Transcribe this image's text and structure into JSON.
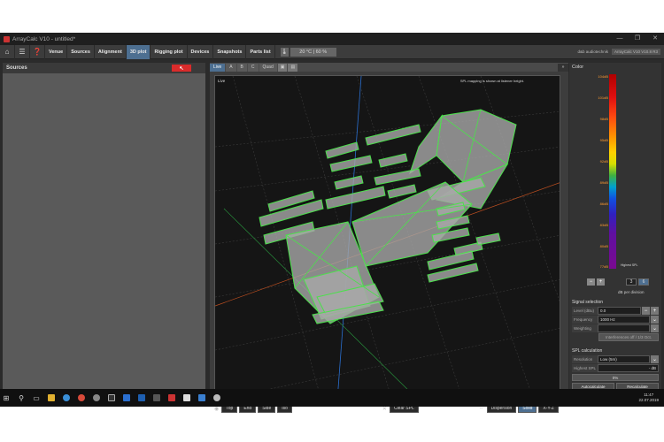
{
  "window": {
    "title": "ArrayCalc V10 - untitled*",
    "controls": [
      "—",
      "❐",
      "✕"
    ]
  },
  "toolbar": {
    "buttons": [
      "Venue",
      "Sources",
      "Alignment",
      "3D plot",
      "Rigging plot",
      "Devices",
      "Snapshots",
      "Parts list"
    ],
    "active": "3D plot",
    "temperature": "20 °C | 60 %",
    "brand_left": "d&b audiotechnik",
    "brand_right": "ArrayCalc V10\nV10.8 R3"
  },
  "sources_panel": {
    "title": "Sources"
  },
  "view": {
    "tabs": [
      "Live",
      "A",
      "B",
      "C",
      "Quad"
    ],
    "active_tab": "Live",
    "scene_label": "Live",
    "scene_note": "SPL mapping is shown at listener height.",
    "view_buttons": [
      "Top",
      "End",
      "Side",
      "Iso"
    ],
    "clear_label": "Clear SPL",
    "render_buttons": [
      "Dispersion",
      "Solid",
      "X-Y-Z"
    ],
    "active_render": "Solid"
  },
  "color_panel": {
    "title": "Color",
    "scale_labels": [
      "104dB",
      "101dB",
      "98dB",
      "95dB",
      "92dB",
      "89dB",
      "86dB",
      "83dB",
      "80dB",
      "77dB"
    ],
    "hint": "Highest SPL",
    "step_values": [
      "3",
      "6"
    ],
    "active_step": "6",
    "per_division": "dB per division"
  },
  "signal_selection": {
    "title": "Signal selection",
    "level_label": "Level (dBu)",
    "level_value": "0.0",
    "frequency_label": "Frequency",
    "frequency_value": "1000 Hz",
    "weighting_label": "Weighting",
    "weighting_value": "",
    "interference_button": "Interferences off / 1/3 Oct."
  },
  "spl_calculation": {
    "title": "SPL calculation",
    "resolution_label": "Resolution",
    "resolution_value": "Low (5m)",
    "highest_label": "Highest SPL",
    "highest_value": "- dB",
    "progress": "0%",
    "autocalc": "Autocalculate",
    "recalc": "Recalculate"
  },
  "taskbar": {
    "time": "11:47",
    "date": "22.07.2019"
  }
}
